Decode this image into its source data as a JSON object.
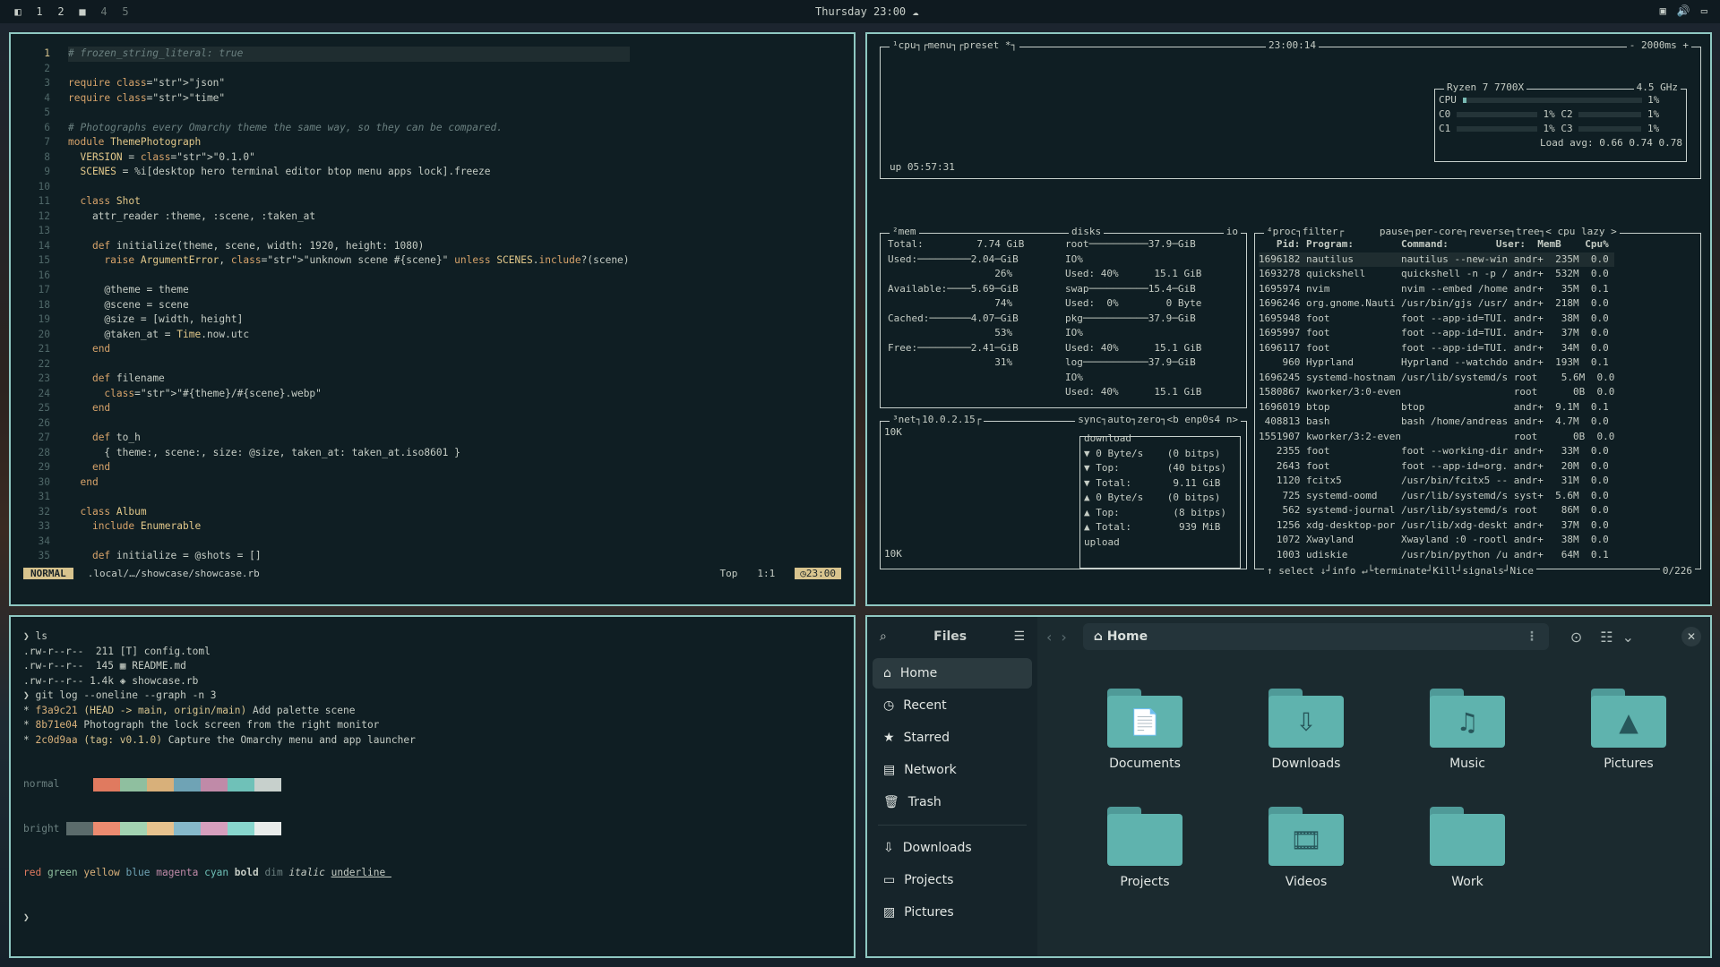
{
  "topbar": {
    "workspaces": [
      "1",
      "2",
      "",
      "4",
      "5"
    ],
    "clock": "Thursday 23:00"
  },
  "editor": {
    "lines": [
      "# frozen_string_literal: true",
      "",
      "require \"json\"",
      "require \"time\"",
      "",
      "# Photographs every Omarchy theme the same way, so they can be compared.",
      "module ThemePhotograph",
      "  VERSION = \"0.1.0\"",
      "  SCENES = %i[desktop hero terminal editor btop menu apps lock].freeze",
      "",
      "  class Shot",
      "    attr_reader :theme, :scene, :taken_at",
      "",
      "    def initialize(theme, scene, width: 1920, height: 1080)",
      "      raise ArgumentError, \"unknown scene #{scene}\" unless SCENES.include?(scene)",
      "",
      "      @theme = theme",
      "      @scene = scene",
      "      @size = [width, height]",
      "      @taken_at = Time.now.utc",
      "    end",
      "",
      "    def filename",
      "      \"#{theme}/#{scene}.webp\"",
      "    end",
      "",
      "    def to_h",
      "      { theme:, scene:, size: @size, taken_at: taken_at.iso8601 }",
      "    end",
      "  end",
      "",
      "  class Album",
      "    include Enumerable",
      "",
      "    def initialize = @shots = []"
    ],
    "mode": "NORMAL",
    "path": ".local/…/showcase/showcase.rb",
    "pos": "Top",
    "cursor": "1:1",
    "time": "23:00"
  },
  "btop": {
    "cpu_title": "¹cpu┐┌menu┐┌preset *┐",
    "clock": "23:00:14",
    "interval": "- 2000ms +",
    "uptime": "up 05:57:31",
    "cpu_name": "Ryzen 7 7700X",
    "cpu_freq": "4.5 GHz",
    "cpu_lines": [
      "CPU",
      "C0",
      "C1"
    ],
    "cpu_pct": [
      "1%",
      "1%",
      "1%"
    ],
    "c2": "C2",
    "c3": "C3",
    "load": "Load avg: 0.66 0.74 0.78",
    "mem_title": "²mem",
    "disks_title": "disks",
    "io": "io",
    "mem_lines": [
      "Total:         7.74 GiB",
      "Used:─────────2.04─GiB",
      "                  26%",
      "Available:────5.69─GiB",
      "                  74%",
      "Cached:───────4.07─GiB",
      "                  53%",
      "Free:─────────2.41─GiB",
      "                  31%"
    ],
    "disk_lines": [
      "root──────────37.9─GiB",
      "IO%",
      "Used: 40%      15.1 GiB",
      "swap──────────15.4─GiB",
      "Used:  0%        0 Byte",
      "pkg───────────37.9─GiB",
      "IO%",
      "Used: 40%      15.1 GiB",
      "log───────────37.9─GiB",
      "IO%",
      "Used: 40%      15.1 GiB"
    ],
    "net_title": "³net┐10.0.2.15┌",
    "net_tags": "sync┐auto┐zero┐<b enp0s4 n>",
    "net_lines": [
      "download",
      "▼ 0 Byte/s    (0 bitps)",
      "▼ Top:        (40 bitps)",
      "▼ Total:       9.11 GiB",
      "",
      "▲ 0 Byte/s    (0 bitps)",
      "▲ Top:         (8 bitps)",
      "▲ Total:        939 MiB",
      "upload"
    ],
    "net_scale": [
      "10K",
      "10K"
    ],
    "proc_title": "⁴proc┐filter┌      pause┐per-core┐reverse┐tree┐< cpu lazy >",
    "proc_header": "   Pid: Program:        Command:        User:  MemB    Cpu%",
    "proc_rows": [
      "1696182 nautilus        nautilus --new-win andr+  235M  0.0",
      "1693278 quickshell      quickshell -n -p / andr+  532M  0.0",
      "1695974 nvim            nvim --embed /home andr+   35M  0.1",
      "1696246 org.gnome.Nauti /usr/bin/gjs /usr/ andr+  218M  0.0",
      "1695948 foot            foot --app-id=TUI. andr+   38M  0.0",
      "1695997 foot            foot --app-id=TUI. andr+   37M  0.0",
      "1696117 foot            foot --app-id=TUI. andr+   34M  0.0",
      "    960 Hyprland        Hyprland --watchdo andr+  193M  0.1",
      "1696245 systemd-hostnam /usr/lib/systemd/s root    5.6M  0.0",
      "1580867 kworker/3:0-even                   root      0B  0.0",
      "1696019 btop            btop               andr+  9.1M  0.1",
      " 408813 bash            bash /home/andreas andr+  4.7M  0.0",
      "1551907 kworker/3:2-even                   root      0B  0.0",
      "   2355 foot            foot --working-dir andr+   33M  0.0",
      "   2643 foot            foot --app-id=org. andr+   20M  0.0",
      "   1120 fcitx5          /usr/bin/fcitx5 -- andr+   31M  0.0",
      "    725 systemd-oomd    /usr/lib/systemd/s syst+  5.6M  0.0",
      "    562 systemd-journal /usr/lib/systemd/s root    86M  0.0",
      "   1256 xdg-desktop-por /usr/lib/xdg-deskt andr+   37M  0.0",
      "   1072 Xwayland        Xwayland :0 -rootl andr+   38M  0.0",
      "   1003 udiskie         /usr/bin/python /u andr+   64M  0.1"
    ],
    "proc_footer": "↑ select ↓┘info ↵└terminate┘Kill┘signals┘Nice",
    "proc_count": "0/226"
  },
  "terminal": {
    "lines": [
      "❯ ls",
      ".rw-r--r--  211 [T] config.toml",
      ".rw-r--r--  145 ▦ README.md",
      ".rw-r--r-- 1.4k ◈ showcase.rb",
      "❯ git log --oneline --graph -n 3",
      "* f3a9c21 (HEAD -> main, origin/main) Add palette scene",
      "* 8b71e04 Photograph the lock screen from the right monitor",
      "* 2c0d9aa (tag: v0.1.0) Capture the Omarchy menu and app launcher"
    ],
    "normal_label": "normal",
    "bright_label": "bright",
    "normal_colors": [
      "#0f1e23",
      "#e07a5f",
      "#8fbf9f",
      "#d8b07a",
      "#6fa3b5",
      "#c08aa8",
      "#6fc1b8",
      "#c7d0cc"
    ],
    "bright_colors": [
      "#5b6b6b",
      "#ec8b70",
      "#a3d3b2",
      "#e6c28e",
      "#86b9ca",
      "#d69fbd",
      "#88d6cd",
      "#e8ecea"
    ],
    "styles": [
      "red",
      "green",
      "yellow",
      "blue",
      "magenta",
      "cyan",
      "bold",
      "dim",
      "italic",
      "underline"
    ],
    "prompt": "❯"
  },
  "files": {
    "title": "Files",
    "location": "Home",
    "sidebar": [
      "Home",
      "Recent",
      "Starred",
      "Network",
      "Trash",
      "Downloads",
      "Projects",
      "Pictures"
    ],
    "sidebar_icons": [
      "⌂",
      "◷",
      "★",
      "▤",
      "🗑",
      "⇩",
      "▭",
      "▨"
    ],
    "folders": [
      {
        "name": "Documents",
        "glyph": "📄"
      },
      {
        "name": "Downloads",
        "glyph": "⇩"
      },
      {
        "name": "Music",
        "glyph": "♫"
      },
      {
        "name": "Pictures",
        "glyph": "▲"
      },
      {
        "name": "Projects",
        "glyph": ""
      },
      {
        "name": "Videos",
        "glyph": "🎞"
      },
      {
        "name": "Work",
        "glyph": ""
      }
    ]
  }
}
